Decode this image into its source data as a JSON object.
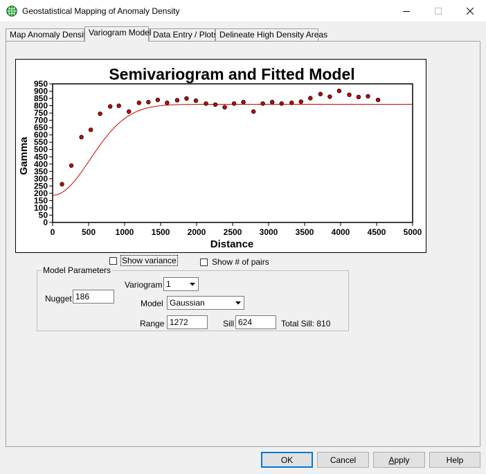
{
  "window": {
    "title": "Geostatistical Mapping of Anomaly Density"
  },
  "tabs": [
    {
      "label": "Map Anomaly Density"
    },
    {
      "label": "Variogram Model"
    },
    {
      "label": "Data Entry / Plots"
    },
    {
      "label": "Delineate High Density Areas"
    }
  ],
  "chart_data": {
    "type": "scatter",
    "title": "Semivariogram and Fitted Model",
    "xlabel": "Distance",
    "ylabel": "Gamma",
    "xlim": [
      0,
      5000
    ],
    "ylim": [
      0,
      950
    ],
    "xticks": [
      0,
      500,
      1000,
      1500,
      2000,
      2500,
      3000,
      3500,
      4000,
      4500,
      5000
    ],
    "yticks": [
      0,
      50,
      100,
      150,
      200,
      250,
      300,
      350,
      400,
      450,
      500,
      550,
      600,
      650,
      700,
      750,
      800,
      850,
      900,
      950
    ],
    "grid": false,
    "points": {
      "x": [
        130,
        260,
        400,
        530,
        660,
        800,
        920,
        1060,
        1200,
        1330,
        1460,
        1590,
        1730,
        1860,
        1990,
        2130,
        2260,
        2390,
        2520,
        2650,
        2790,
        2920,
        3050,
        3180,
        3320,
        3450,
        3580,
        3720,
        3850,
        3980,
        4120,
        4250,
        4380,
        4520
      ],
      "y": [
        262,
        390,
        585,
        635,
        745,
        795,
        800,
        760,
        820,
        825,
        840,
        820,
        838,
        850,
        835,
        815,
        808,
        790,
        815,
        825,
        760,
        815,
        825,
        815,
        820,
        828,
        852,
        880,
        862,
        902,
        875,
        860,
        865,
        840
      ],
      "color": "#cc0000"
    },
    "model": {
      "type": "gaussian",
      "nugget": 186,
      "sill": 624,
      "range": 1272,
      "color": "#cc0000"
    }
  },
  "checkboxes": {
    "show_variance": {
      "label": "Show variance",
      "checked": false
    },
    "show_pairs": {
      "label": "Show # of pairs",
      "checked": false
    }
  },
  "params": {
    "group_title": "Model Parameters",
    "nugget_label": "Nugget",
    "nugget_value": "186",
    "variogram_label": "Variogram",
    "variogram_value": "1",
    "model_label": "Model",
    "model_value": "Gaussian",
    "range_label": "Range",
    "range_value": "1272",
    "sill_label": "Sill",
    "sill_value": "624",
    "total_sill": "Total Sill: 810"
  },
  "buttons": {
    "ok": "OK",
    "cancel": "Cancel",
    "apply_pre": "",
    "apply_u": "A",
    "apply_post": "pply",
    "help": "Help"
  },
  "colors": {
    "accent": "#0078d7",
    "series": "#cc0000"
  }
}
